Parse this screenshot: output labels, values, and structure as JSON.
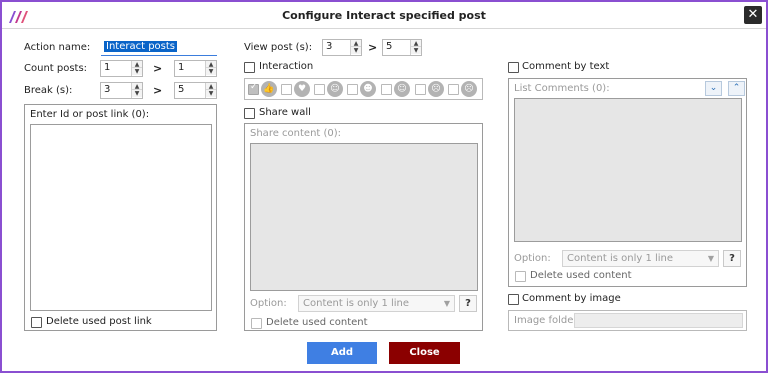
{
  "window": {
    "title": "Configure Interact specified post",
    "close_glyph": "✕",
    "logo_icon": "app-logo-icon"
  },
  "left": {
    "action_name_label": "Action name:",
    "action_name_value": "Interact posts",
    "count_posts_label": "Count posts:",
    "count_posts_from": "1",
    "count_posts_to": "1",
    "break_label": "Break (s):",
    "break_from": "3",
    "break_to": "5",
    "gt": ">",
    "ids_label": "Enter Id or post link (0):",
    "delete_used_post_link": "Delete used post link"
  },
  "middle": {
    "view_post_label": "View post (s):",
    "view_post_from": "3",
    "view_post_to": "5",
    "gt": ">",
    "interaction_label": "Interaction",
    "reactions": [
      {
        "icon": "like-icon",
        "glyph": "👍",
        "checked": true
      },
      {
        "icon": "love-icon",
        "glyph": "♥",
        "checked": false
      },
      {
        "icon": "care-icon",
        "glyph": "☺",
        "checked": false
      },
      {
        "icon": "haha-icon",
        "glyph": "☻",
        "checked": false
      },
      {
        "icon": "wow-icon",
        "glyph": "☺",
        "checked": false
      },
      {
        "icon": "sad-icon",
        "glyph": "☹",
        "checked": false
      },
      {
        "icon": "angry-icon",
        "glyph": "☹",
        "checked": false
      }
    ],
    "share_wall_label": "Share wall",
    "share_content_label": "Share content (0):",
    "option_label": "Option:",
    "option_value": "Content is only 1 line",
    "help_label": "?",
    "delete_used_content": "Delete used content"
  },
  "right": {
    "comment_by_text_label": "Comment by text",
    "list_comments_label": "List Comments (0):",
    "option_label": "Option:",
    "option_value": "Content is only 1 line",
    "help_label": "?",
    "delete_used_content": "Delete used content",
    "comment_by_image_label": "Comment by image",
    "image_folder_label": "Image folder:",
    "down_glyph": "⌄",
    "up_glyph": "⌃"
  },
  "footer": {
    "add_label": "Add",
    "close_label": "Close"
  },
  "colors": {
    "frame": "#8a4fd1",
    "add": "#3f7fe3",
    "close": "#8b0000",
    "selection": "#0a64c8"
  }
}
